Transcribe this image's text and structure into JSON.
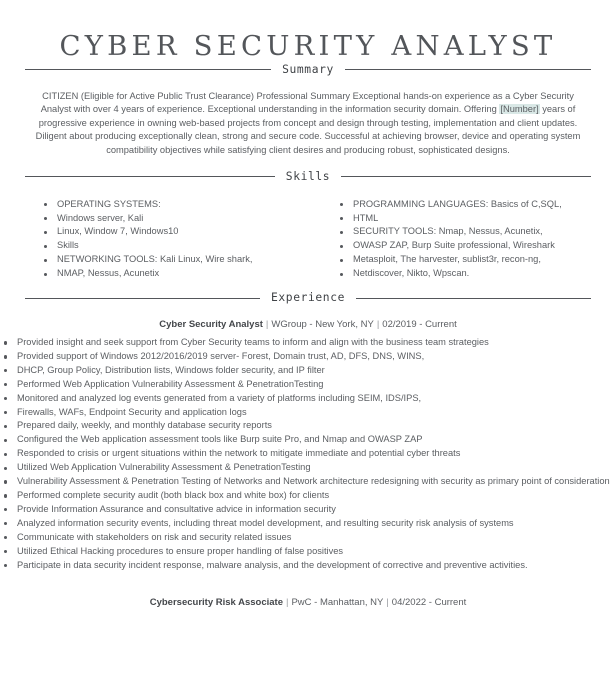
{
  "document": {
    "title": "CYBER SECURITY ANALYST"
  },
  "sections": {
    "summary": {
      "heading": "Summary",
      "text_before_highlight": "CITIZEN (Eligible for Active Public Trust Clearance) Professional Summary Exceptional hands-on experience as a Cyber Security Analyst with over 4 years of experience. Exceptional understanding in the information security domain. Offering ",
      "highlight": "[Number]",
      "text_after_highlight": " years of progressive experience in owning web-based projects from concept and design through testing, implementation and client updates. Diligent about producing exceptionally clean, strong and secure code. Successful at achieving browser, device and operating system compatibility objectives while satisfying client desires and producing robust, sophisticated designs."
    },
    "skills": {
      "heading": "Skills",
      "left_column": [
        "OPERATING SYSTEMS:",
        "Windows server, Kali",
        "Linux, Window 7, Windows10",
        "Skills",
        "NETWORKING TOOLS: Kali Linux, Wire shark,",
        "NMAP, Nessus, Acunetix"
      ],
      "right_column": [
        "PROGRAMMING LANGUAGES: Basics of C,SQL,",
        "HTML",
        "SECURITY TOOLS: Nmap, Nessus, Acunetix,",
        "OWASP ZAP, Burp Suite professional, Wireshark",
        "Metasploit, The harvester, sublist3r, recon-ng,",
        "Netdiscover, Nikto, Wpscan."
      ]
    },
    "experience": {
      "heading": "Experience",
      "jobs": [
        {
          "title": "Cyber Security Analyst",
          "company_location": "WGroup - New York, NY",
          "dates": "02/2019 - Current",
          "bullets": [
            "Provided insight and seek support from Cyber Security teams to inform and align with the business team strategies",
            "Provided support of Windows 2012/2016/2019 server- Forest, Domain trust, AD, DFS, DNS, WINS,",
            "DHCP, Group Policy, Distribution lists, Windows folder security, and IP filter",
            "Performed Web Application Vulnerability Assessment & PenetrationTesting",
            "Monitored and analyzed log events generated from a variety of platforms including SEIM, IDS/IPS,",
            "Firewalls, WAFs, Endpoint Security and application logs",
            "Prepared daily, weekly, and monthly database security reports",
            "Configured the Web application assessment tools like Burp suite Pro, and Nmap and OWASP ZAP",
            "Responded to crisis or urgent situations within the network to mitigate immediate and potential cyber threats",
            "Utilized Web Application Vulnerability Assessment & PenetrationTesting",
            "Vulnerability Assessment & Penetration Testing of Networks and Network architecture redesigning with security as primary point of consideration",
            "Performed complete security audit (both black box and white box) for clients",
            "Provide Information Assurance and consultative advice in information security",
            "Analyzed information security events, including threat model development, and resulting security risk analysis of systems",
            "Communicate with stakeholders on risk and security related issues",
            "Utilized Ethical Hacking procedures to ensure proper handling of false positives",
            "Participate in data security incident response, malware analysis, and the development of corrective and preventive activities."
          ]
        },
        {
          "title": "Cybersecurity Risk Associate",
          "company_location": "PwC - Manhattan, NY",
          "dates": "04/2022 - Current",
          "bullets": []
        }
      ],
      "separator": "|"
    }
  },
  "theme": {
    "text_color": "#53565a",
    "body_text_color": "#5b5e62",
    "rule_color": "#53565a",
    "highlight_color": "#d9e8e6",
    "background": "#ffffff"
  }
}
